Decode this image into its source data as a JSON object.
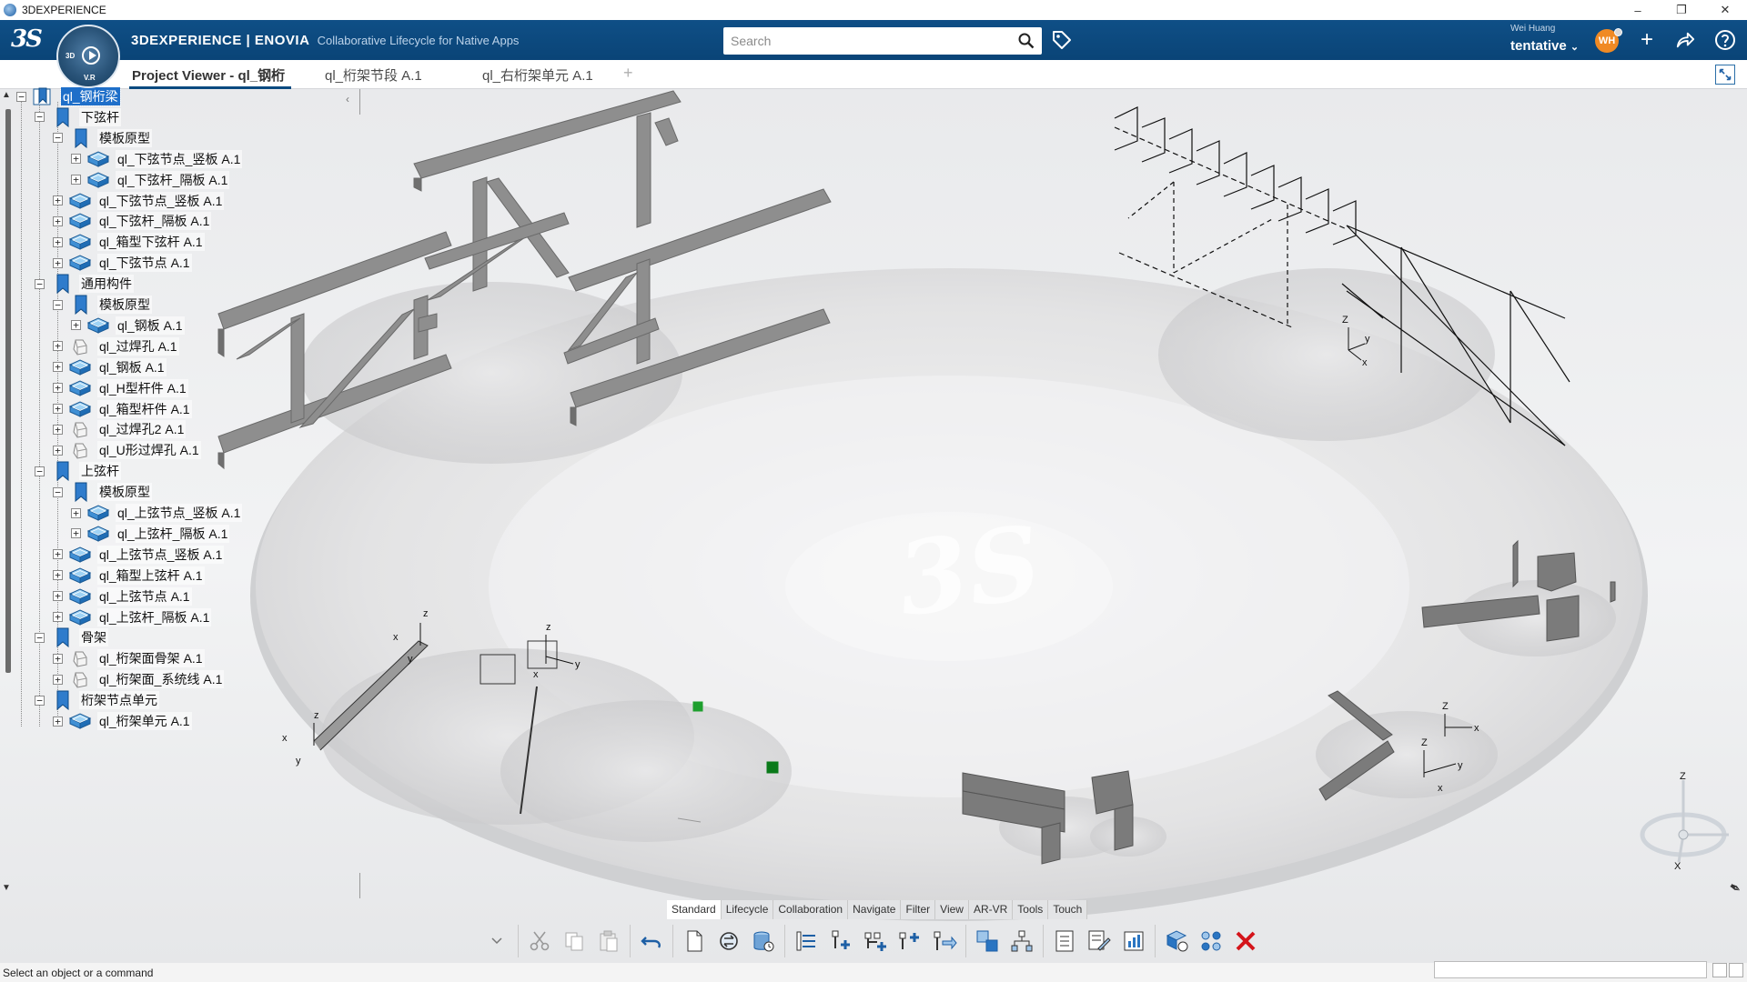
{
  "window": {
    "title": "3DEXPERIENCE"
  },
  "header": {
    "brand_bold": "3DEXPERIENCE | ENOVIA",
    "brand_sub": "Collaborative Lifecycle for Native Apps",
    "search_placeholder": "Search",
    "user_name": "Wei Huang",
    "user_status": "tentative",
    "avatar_initials": "WH"
  },
  "compass": {
    "top": "3D",
    "bottom": "V.R"
  },
  "tabs": [
    {
      "label": "Project Viewer - ql_钢桁",
      "active": true
    },
    {
      "label": "ql_桁架节段 A.1",
      "active": false
    },
    {
      "label": "ql_右桁架单元 A.1",
      "active": false
    }
  ],
  "tree": [
    {
      "label": "ql_钢桁梁",
      "depth": 0,
      "icon": "bookmark-root-icon",
      "toggle": "−",
      "selected": true
    },
    {
      "label": "下弦杆",
      "depth": 1,
      "icon": "bookmark-icon",
      "toggle": "−"
    },
    {
      "label": "模板原型",
      "depth": 2,
      "icon": "bookmark-icon",
      "toggle": "−"
    },
    {
      "label": "ql_下弦节点_竖板 A.1",
      "depth": 3,
      "icon": "part-icon",
      "toggle": "+"
    },
    {
      "label": "ql_下弦杆_隔板 A.1",
      "depth": 3,
      "icon": "part-icon",
      "toggle": "+"
    },
    {
      "label": "ql_下弦节点_竖板 A.1",
      "depth": 2,
      "icon": "part-icon",
      "toggle": "+"
    },
    {
      "label": "ql_下弦杆_隔板 A.1",
      "depth": 2,
      "icon": "part-icon",
      "toggle": "+"
    },
    {
      "label": "ql_箱型下弦杆 A.1",
      "depth": 2,
      "icon": "part-icon",
      "toggle": "+"
    },
    {
      "label": "ql_下弦节点 A.1",
      "depth": 2,
      "icon": "part-icon",
      "toggle": "+"
    },
    {
      "label": "通用构件",
      "depth": 1,
      "icon": "bookmark-icon",
      "toggle": "−"
    },
    {
      "label": "模板原型",
      "depth": 2,
      "icon": "bookmark-icon",
      "toggle": "−"
    },
    {
      "label": "ql_钢板 A.1",
      "depth": 3,
      "icon": "part-icon",
      "toggle": "+"
    },
    {
      "label": "ql_过焊孔 A.1",
      "depth": 2,
      "icon": "shape-icon",
      "toggle": "+"
    },
    {
      "label": "ql_钢板 A.1",
      "depth": 2,
      "icon": "part-icon",
      "toggle": "+"
    },
    {
      "label": "ql_H型杆件 A.1",
      "depth": 2,
      "icon": "part-icon",
      "toggle": "+"
    },
    {
      "label": "ql_箱型杆件 A.1",
      "depth": 2,
      "icon": "part-icon",
      "toggle": "+"
    },
    {
      "label": "ql_过焊孔2 A.1",
      "depth": 2,
      "icon": "shape-icon",
      "toggle": "+"
    },
    {
      "label": "ql_U形过焊孔 A.1",
      "depth": 2,
      "icon": "shape-icon",
      "toggle": "+"
    },
    {
      "label": "上弦杆",
      "depth": 1,
      "icon": "bookmark-icon",
      "toggle": "−"
    },
    {
      "label": "模板原型",
      "depth": 2,
      "icon": "bookmark-icon",
      "toggle": "−"
    },
    {
      "label": "ql_上弦节点_竖板 A.1",
      "depth": 3,
      "icon": "part-icon",
      "toggle": "+"
    },
    {
      "label": "ql_上弦杆_隔板 A.1",
      "depth": 3,
      "icon": "part-icon",
      "toggle": "+"
    },
    {
      "label": "ql_上弦节点_竖板 A.1",
      "depth": 2,
      "icon": "part-icon",
      "toggle": "+"
    },
    {
      "label": "ql_箱型上弦杆 A.1",
      "depth": 2,
      "icon": "part-icon",
      "toggle": "+"
    },
    {
      "label": "ql_上弦节点 A.1",
      "depth": 2,
      "icon": "part-icon",
      "toggle": "+"
    },
    {
      "label": "ql_上弦杆_隔板 A.1",
      "depth": 2,
      "icon": "part-icon",
      "toggle": "+"
    },
    {
      "label": "骨架",
      "depth": 1,
      "icon": "bookmark-icon",
      "toggle": "−"
    },
    {
      "label": "ql_桁架面骨架 A.1",
      "depth": 2,
      "icon": "shape-icon",
      "toggle": "+"
    },
    {
      "label": "ql_桁架面_系统线 A.1",
      "depth": 2,
      "icon": "shape-icon",
      "toggle": "+"
    },
    {
      "label": "桁架节点单元",
      "depth": 1,
      "icon": "bookmark-icon",
      "toggle": "−"
    },
    {
      "label": "ql_桁架单元 A.1",
      "depth": 2,
      "icon": "part-icon",
      "toggle": "+"
    }
  ],
  "action_tabs": [
    "Standard",
    "Lifecycle",
    "Collaboration",
    "Navigate",
    "Filter",
    "View",
    "AR-VR",
    "Tools",
    "Touch"
  ],
  "status": {
    "message": "Select an object or a command"
  },
  "colors": {
    "header_bg": "#0a4477",
    "selection": "#1f6fc9",
    "accent_orange": "#f08a24",
    "delete_red": "#d4141a"
  }
}
